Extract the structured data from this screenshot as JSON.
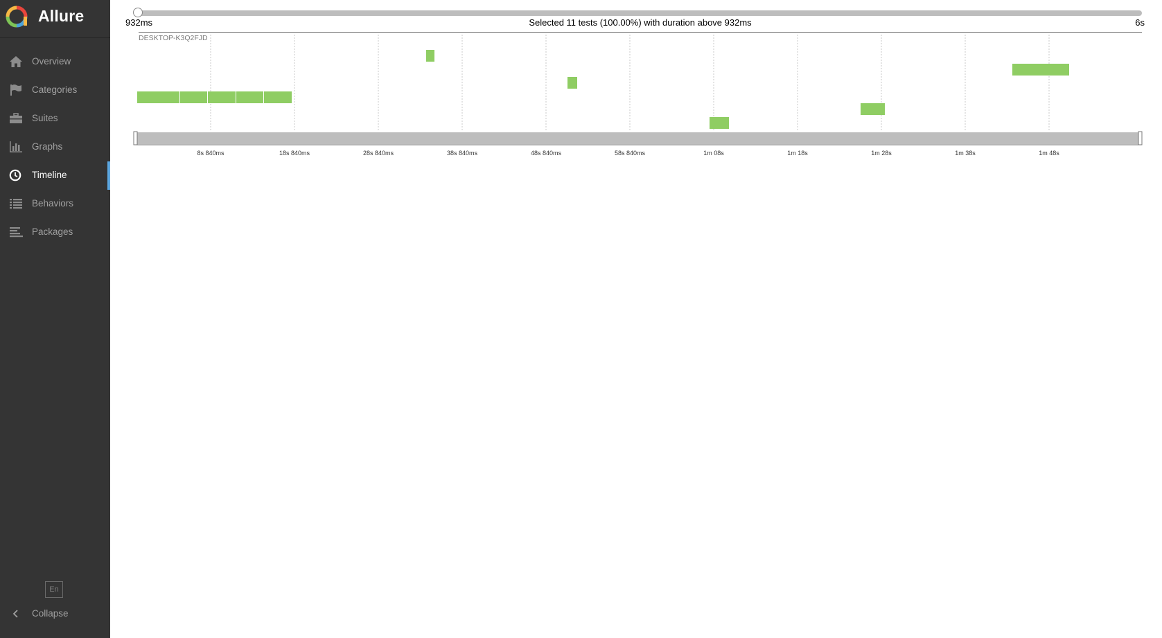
{
  "app": {
    "title": "Allure"
  },
  "sidebar": {
    "items": [
      {
        "label": "Overview",
        "icon": "home-icon",
        "active": false
      },
      {
        "label": "Categories",
        "icon": "flag-icon",
        "active": false
      },
      {
        "label": "Suites",
        "icon": "briefcase-icon",
        "active": false
      },
      {
        "label": "Graphs",
        "icon": "bar-chart-icon",
        "active": false
      },
      {
        "label": "Timeline",
        "icon": "clock-icon",
        "active": true
      },
      {
        "label": "Behaviors",
        "icon": "list-icon",
        "active": false
      },
      {
        "label": "Packages",
        "icon": "align-left-icon",
        "active": false
      }
    ],
    "language": "En",
    "collapse_label": "Collapse"
  },
  "timeline": {
    "duration_filter": {
      "min_label": "932ms",
      "max_label": "6s",
      "selected_text": "Selected 11 tests (100.00%) with duration above 932ms"
    },
    "host": "DESKTOP-K3Q2FJD",
    "axis_ticks": [
      "8s 840ms",
      "18s 840ms",
      "28s 840ms",
      "38s 840ms",
      "48s 840ms",
      "58s 840ms",
      "1m 08s",
      "1m 18s",
      "1m 28s",
      "1m 38s",
      "1m 48s"
    ],
    "bar_color": "#8fcd63",
    "accent_color": "#5da7e0"
  }
}
